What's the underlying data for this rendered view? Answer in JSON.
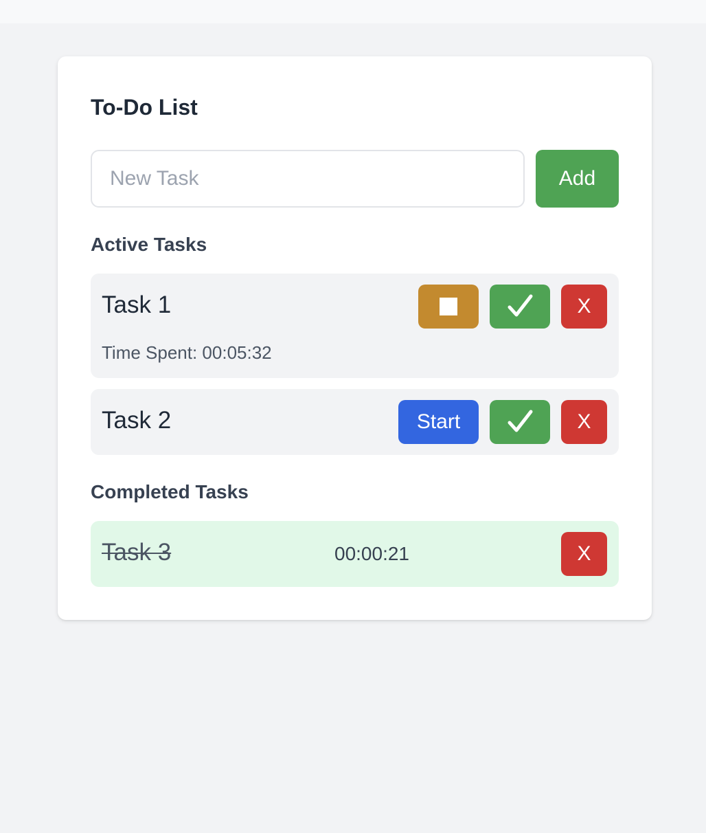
{
  "app": {
    "title": "To-Do List"
  },
  "new_task": {
    "placeholder": "New Task",
    "value": "",
    "add_label": "Add"
  },
  "active": {
    "heading": "Active Tasks",
    "tasks": [
      {
        "name": "Task 1",
        "running": true,
        "time_label": "Time Spent: 00:05:32",
        "stop_icon": "stop-square-icon",
        "complete_icon": "checkmark-icon",
        "delete_label": "X"
      },
      {
        "name": "Task 2",
        "running": false,
        "start_label": "Start",
        "complete_icon": "checkmark-icon",
        "delete_label": "X"
      }
    ]
  },
  "completed": {
    "heading": "Completed Tasks",
    "tasks": [
      {
        "name": "Task 3",
        "time": "00:00:21",
        "delete_label": "X"
      }
    ]
  },
  "colors": {
    "stop": "#c38a2f",
    "complete": "#4fa354",
    "delete": "#cf3833",
    "start": "#3366e0",
    "completed_row": "#e1f8e8"
  }
}
